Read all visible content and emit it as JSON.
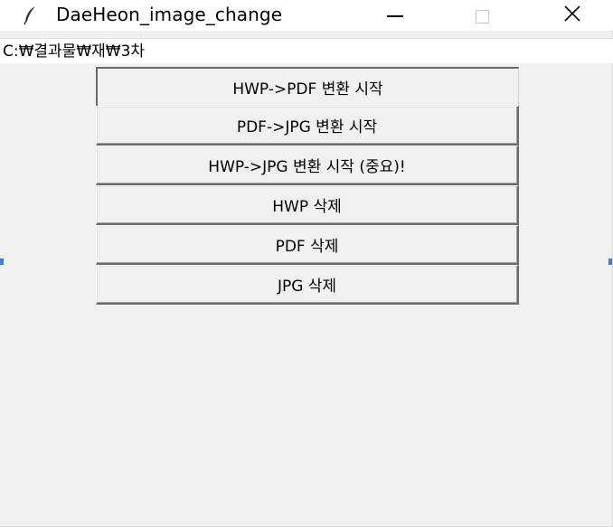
{
  "window": {
    "title": "DaeHeon_image_change",
    "app_icon": "feather-icon",
    "controls": {
      "minimize_icon": "minimize-icon",
      "maximize_icon": "maximize-icon",
      "close_icon": "close-icon",
      "close_glyph": "✕"
    }
  },
  "path_label": "C:₩결과물₩재₩3차",
  "buttons": [
    {
      "label": "HWP->PDF 변환 시작"
    },
    {
      "label": "PDF->JPG 변환 시작"
    },
    {
      "label": "HWP->JPG 변환 시작 (중요)!"
    },
    {
      "label": "HWP 삭제"
    },
    {
      "label": "PDF 삭제"
    },
    {
      "label": "JPG 삭제"
    }
  ],
  "colors": {
    "window_background": "#f0f0f0",
    "titlebar_background": "#ffffff",
    "accent": "#4a7bd0"
  }
}
